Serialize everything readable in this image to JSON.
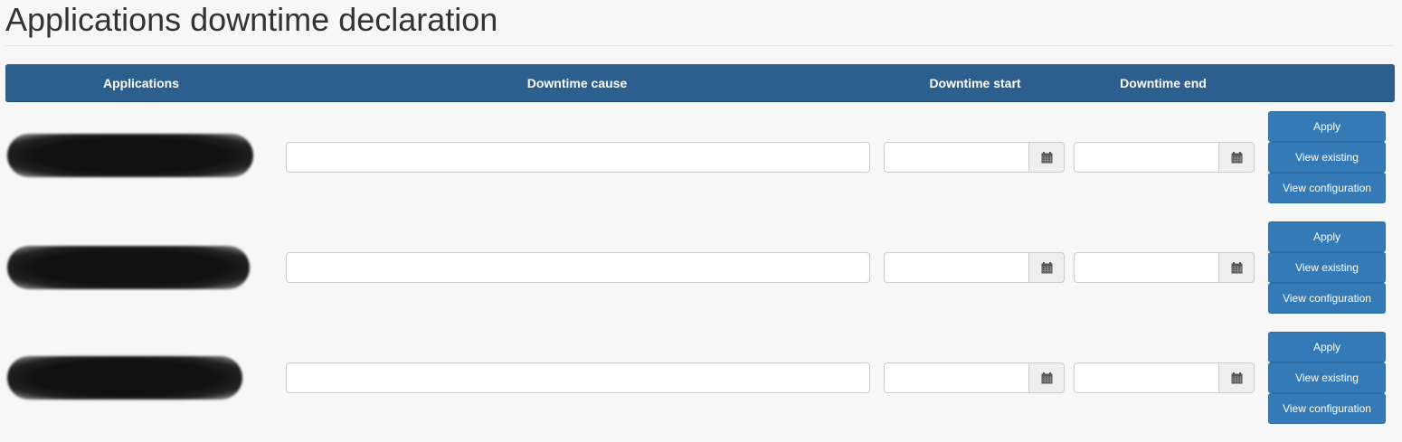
{
  "page": {
    "title": "Applications downtime declaration"
  },
  "table": {
    "headers": {
      "applications": "Applications",
      "downtime_cause": "Downtime cause",
      "downtime_start": "Downtime start",
      "downtime_end": "Downtime end"
    },
    "rows": [
      {
        "cause": "",
        "start": "",
        "end": "",
        "apply_label": "Apply",
        "view_existing_label": "View existing",
        "view_configuration_label": "View configuration"
      },
      {
        "cause": "",
        "start": "",
        "end": "",
        "apply_label": "Apply",
        "view_existing_label": "View existing",
        "view_configuration_label": "View configuration"
      },
      {
        "cause": "",
        "start": "",
        "end": "",
        "apply_label": "Apply",
        "view_existing_label": "View existing",
        "view_configuration_label": "View configuration"
      }
    ]
  },
  "icons": {
    "date_picker": "calendar-icon"
  },
  "colors": {
    "header_bg": "#2c5f8e",
    "button_bg": "#337ab7",
    "page_bg": "#f7f7f7"
  }
}
